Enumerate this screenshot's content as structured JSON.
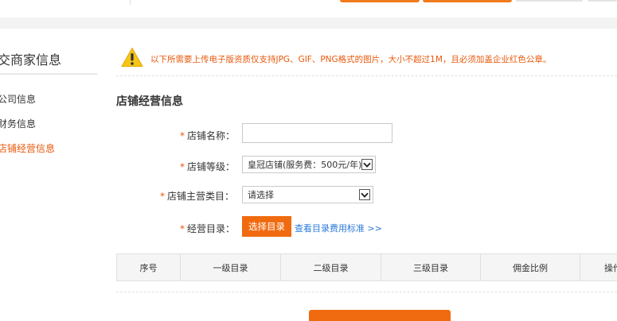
{
  "sidebar": {
    "title": "交商家信息",
    "items": [
      {
        "label": "公司信息"
      },
      {
        "label": "财务信息"
      },
      {
        "label": "店铺经营信息"
      }
    ]
  },
  "notice": {
    "text": "以下所需要上传电子版资质仅支持JPG、GIF、PNG格式的图片，大小不超过1M，且必须加盖企业红色公章。"
  },
  "section": {
    "title": "店铺经营信息"
  },
  "form": {
    "required_mark": "*",
    "store_name": {
      "label": "店铺名称：",
      "value": ""
    },
    "store_level": {
      "label": "店铺等级：",
      "value": "皇冠店铺(服务费：500元/年)"
    },
    "main_category": {
      "label": "店铺主营类目：",
      "value": "请选择"
    },
    "catalog": {
      "label": "经营目录：",
      "button_label": "选择目录",
      "link_text": "查看目录费用标准 >>"
    }
  },
  "table": {
    "columns": [
      "序号",
      "一级目录",
      "二级目录",
      "三级目录",
      "佣金比例",
      "操作"
    ]
  },
  "colors": {
    "accent": "#f06a0f",
    "notice": "#e8590c",
    "link": "#2b7bd8"
  }
}
